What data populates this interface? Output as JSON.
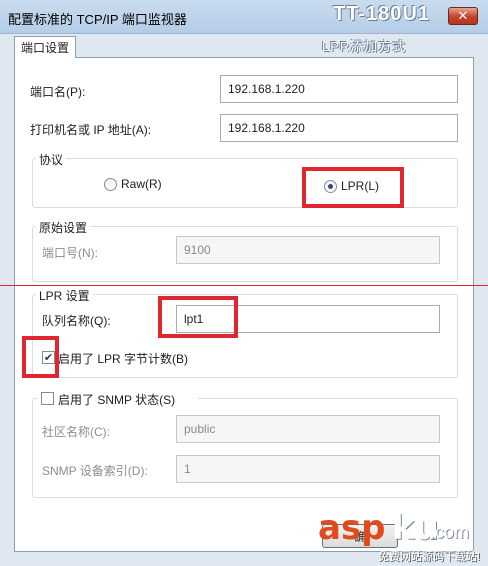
{
  "window": {
    "title": "配置标准的 TCP/IP 端口监视器",
    "brand_overlay": "TT-180U1",
    "subtitle_overlay": "LPR添加方式",
    "close_glyph": "✕"
  },
  "tab": {
    "label": "端口设置"
  },
  "fields": {
    "port_name": {
      "label": "端口名(P):",
      "value": "192.168.1.220"
    },
    "printer_name": {
      "label": "打印机名或 IP 地址(A):",
      "value": "192.168.1.220"
    }
  },
  "protocol": {
    "legend": "协议",
    "raw_label": "Raw(R)",
    "lpr_label": "LPR(L)",
    "selected": "LPR(L)"
  },
  "raw_settings": {
    "legend": "原始设置",
    "port_number_label": "端口号(N):",
    "port_number_value": "9100"
  },
  "lpr_settings": {
    "legend": "LPR 设置",
    "queue_label": "队列名称(Q):",
    "queue_value": "lpt1",
    "byte_count_label": "启用了 LPR 字节计数(B)",
    "byte_count_checked": true
  },
  "snmp": {
    "legend": "启用了 SNMP 状态(S)",
    "enabled": false,
    "community_label": "社区名称(C):",
    "community_value": "public",
    "device_index_label": "SNMP 设备索引(D):",
    "device_index_value": "1"
  },
  "footer": {
    "ok_label": "确"
  },
  "watermark": {
    "asp": "asp",
    "ku": "ku",
    "com": ".com",
    "tagline": "免费网站源码下载站!"
  },
  "colors": {
    "highlight": "#e0262f",
    "window_bg": "#dfe8f1"
  }
}
